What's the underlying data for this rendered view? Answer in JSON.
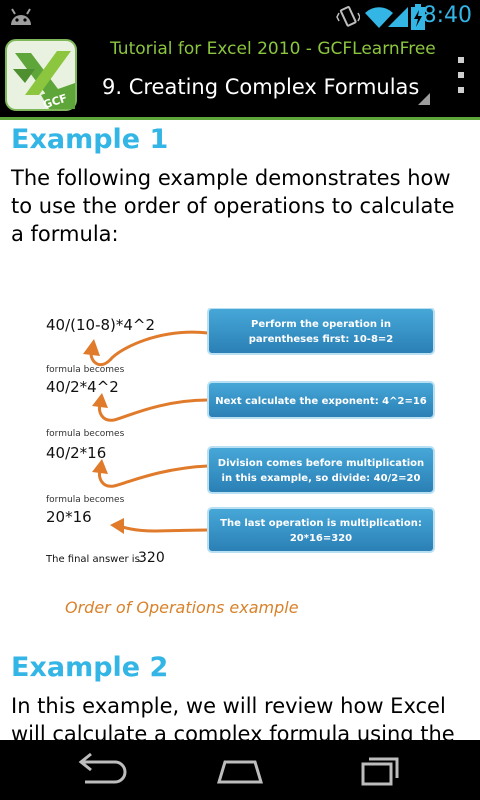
{
  "status": {
    "time": "8:40"
  },
  "actionbar": {
    "app_title": "Tutorial for Excel 2010 - GCFLearnFree",
    "page_title": "9. Creating Complex Formulas",
    "icon_label": "GCF",
    "brand_color": "#5fa63a"
  },
  "content": {
    "example1_heading": "Example 1",
    "example1_text": "The following example demonstrates how to use the order of operations to calculate a formula:",
    "diagram": {
      "steps": [
        {
          "formula": "40/(10-8)*4^2",
          "note_lines": [
            "Perform the operation in",
            "parentheses first: 10-8=2"
          ]
        },
        {
          "formula": "40/2*4^2",
          "note_lines": [
            "Next calculate the exponent: 4^2=16"
          ]
        },
        {
          "formula": "40/2*16",
          "note_lines": [
            "Division comes before multiplication",
            "in this example, so divide: 40/2=20"
          ]
        },
        {
          "formula": "20*16",
          "note_lines": [
            "The last operation is multiplication:",
            "20*16=320"
          ]
        }
      ],
      "becomes_label": "formula becomes",
      "final_label": "The final answer is",
      "final_value": "320"
    },
    "caption": "Order of Operations example",
    "example2_heading": "Example 2",
    "example2_text": "In this example, we will review how Excel will calculate a complex formula using the order"
  }
}
